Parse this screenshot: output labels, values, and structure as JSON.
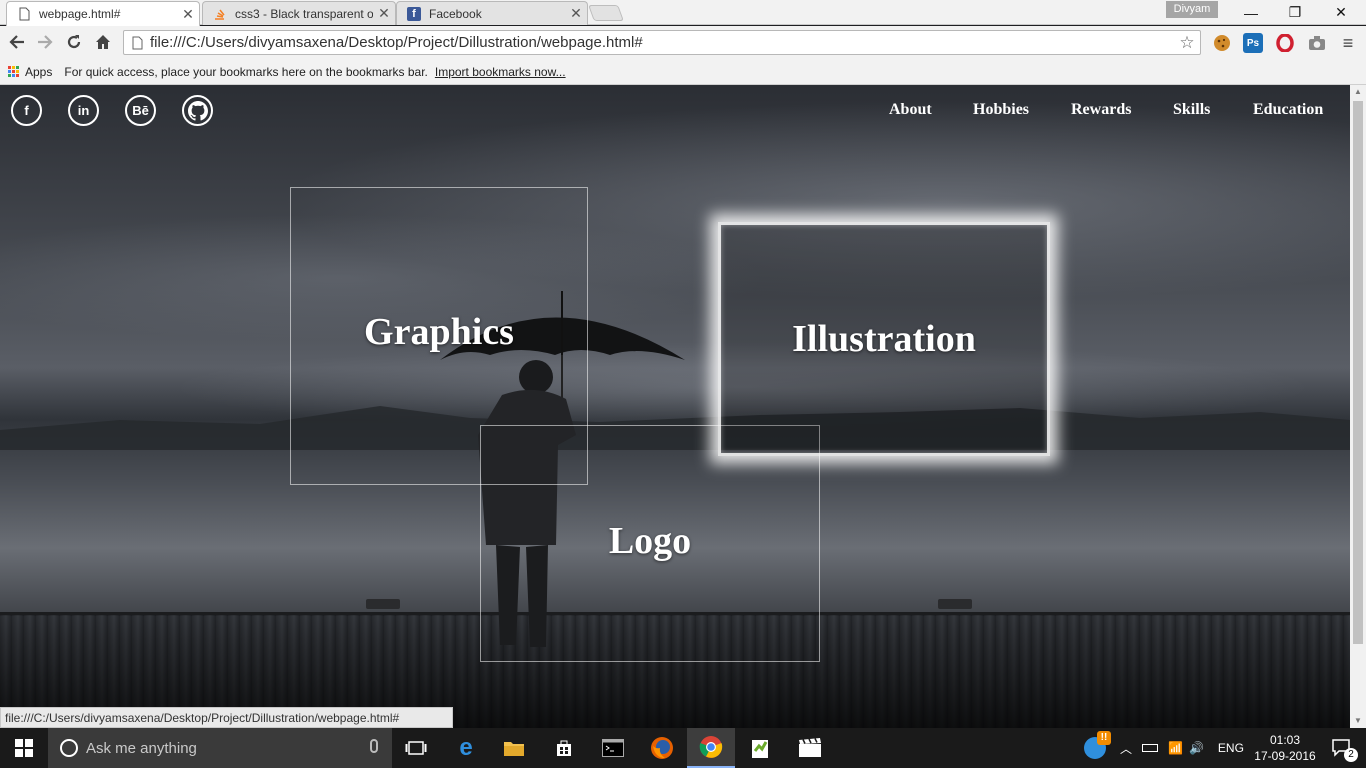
{
  "browser": {
    "tabs": [
      {
        "title": "webpage.html#",
        "active": true,
        "icon": "page-icon"
      },
      {
        "title": "css3 - Black transparent o",
        "active": false,
        "icon": "stackoverflow-icon"
      },
      {
        "title": "Facebook",
        "active": false,
        "icon": "facebook-icon"
      }
    ],
    "profile_name": "Divyam",
    "address": "file:///C:/Users/divyamsaxena/Desktop/Project/Dillustration/webpage.html#",
    "bookmarks": {
      "apps_label": "Apps",
      "hint": "For quick access, place your bookmarks here on the bookmarks bar.",
      "import_link": "Import bookmarks now..."
    },
    "status_url": "file:///C:/Users/divyamsaxena/Desktop/Project/Dillustration/webpage.html#",
    "extensions": [
      {
        "name": "cookie-icon",
        "color": "#d18b2c"
      },
      {
        "name": "photoshop-icon",
        "label": "Ps",
        "color": "#1c6fb8"
      },
      {
        "name": "opera-icon",
        "color": "#d02030"
      },
      {
        "name": "camera-icon",
        "color": "#888888"
      }
    ]
  },
  "page": {
    "social": [
      {
        "name": "facebook-icon",
        "glyph": "f"
      },
      {
        "name": "linkedin-icon",
        "glyph": "in"
      },
      {
        "name": "behance-icon",
        "glyph": "Bē"
      },
      {
        "name": "github-icon",
        "glyph": "GH"
      }
    ],
    "nav": [
      "About",
      "Hobbies",
      "Rewards",
      "Skills",
      "Education"
    ],
    "cards": {
      "graphics": "Graphics",
      "illustration": "Illustration",
      "logo": "Logo"
    }
  },
  "taskbar": {
    "search_placeholder": "Ask me anything",
    "language": "ENG",
    "time": "01:03",
    "date": "17-09-2016",
    "notification_count": "2"
  },
  "colors": {
    "accent": "#8ab4f8",
    "taskbar_bg": "#1a1a1a",
    "chrome_bg": "#f2f2f2"
  }
}
